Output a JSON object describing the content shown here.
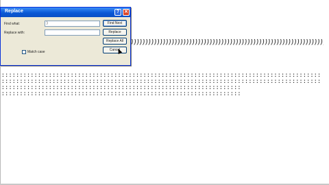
{
  "document": {
    "paren_line": "))))))))))))))))))))))))))))))))))))))))))))))))))))))))))))))))))))))))))))))))))))))))))))))))))))))))))))))))))))))))))))))))))))))))))))))))))))))))))))))))))))))))))))))))))))))))))))))))))))))))))))))",
    "dot_lines": [
      ":::::::::::::::::::::::::::::::::::::::::::::::::::::::::::::::::::::::::::::::::::::::::::::::::::",
      ":::::::::::::::::::::::::::::::::::::::::::::::::::::::::::::::::::::::::::::::::::::::::::::::::::",
      ":::::::::::::::::::::::::::::::::::::::::::::::::::::::::::::::::::::::::",
      "::::::::::::::::::::::::::::::::::::::::::::::::::::::::::::::::::::::::::"
    ]
  },
  "dialog": {
    "title": "Replace",
    "help_glyph": "?",
    "close_glyph": "✕",
    "find_label": "Find what:",
    "find_value": ")",
    "replace_label": "Replace with:",
    "replace_value": "",
    "match_case_label": "Match case",
    "buttons": {
      "find_next": "Find Next",
      "replace": "Replace",
      "replace_all": "Replace All",
      "cancel": "Cancel"
    }
  }
}
